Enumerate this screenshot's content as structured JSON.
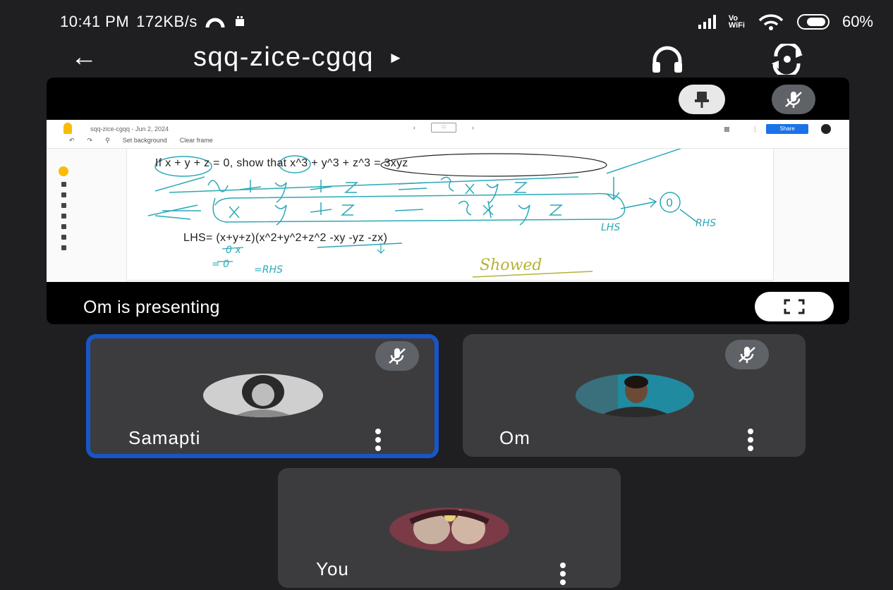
{
  "status_bar": {
    "time": "10:41 PM",
    "network_speed": "172KB/s",
    "vowifi_line1": "Vo",
    "vowifi_line2": "WiFi",
    "battery": "60%"
  },
  "app_bar": {
    "back_icon": "arrow-left-icon",
    "meeting_code": "sqq-zice-cgqq",
    "dropdown_icon": "caret-right-icon",
    "audio_icon": "headphones-icon",
    "switch_camera_icon": "switch-camera-icon"
  },
  "presentation": {
    "presenter_label": "Om is presenting",
    "pin_icon": "pin-icon",
    "mute_icon": "mic-off-icon",
    "fullscreen_icon": "fullscreen-icon",
    "jamboard": {
      "file_title": "sqq-zice-cgqq - Jun 2, 2024",
      "set_background": "Set background",
      "clear_frame": "Clear frame",
      "share": "Share",
      "equation_top": "If x + y + z = 0, show that x^3 + y^3 + z^3 = 3xyz",
      "equation_lhs": "LHS= (x+y+z)(x^2+y^2+z^2 -xy -yz -zx)",
      "handwriting": {
        "lhs": "LHS",
        "zero": "0",
        "rhs": "RHS",
        "zero_x": "0 x",
        "eq_zero": "= 0",
        "eq_rhs": "=RHS",
        "showed": "Showed"
      }
    }
  },
  "participants": [
    {
      "name": "Samapti",
      "muted": true,
      "speaking": true
    },
    {
      "name": "Om",
      "muted": true,
      "speaking": false
    },
    {
      "name": "You",
      "muted": false,
      "speaking": false
    }
  ],
  "colors": {
    "background": "#1f1f21",
    "tile": "#3c3c3e",
    "active_border": "#1656c8",
    "mute_pill": "#5f6368",
    "ink_teal": "#2aa9b7",
    "ink_yellow": "#b5b23a",
    "jamboard_yellow": "#f9bc05",
    "share_blue": "#1a73e8"
  }
}
